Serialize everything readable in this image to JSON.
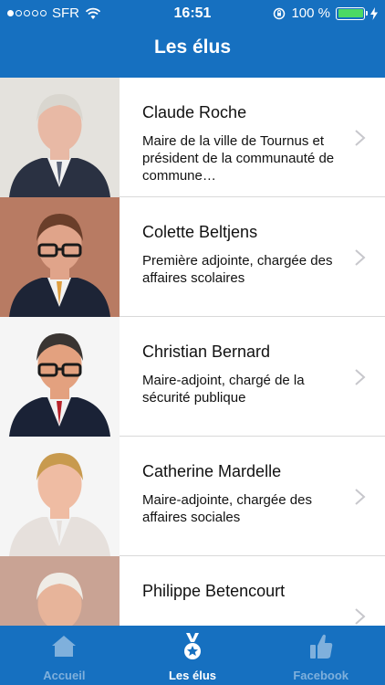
{
  "status_bar": {
    "carrier": "SFR",
    "time": "16:51",
    "battery": "100 %",
    "signal_dots_filled": 1,
    "signal_dots_total": 5
  },
  "nav": {
    "title": "Les élus"
  },
  "list": {
    "items": [
      {
        "name": "Claude Roche",
        "desc": "Maire de la ville de Tournus et président de la communauté de commune…",
        "photo_bg": "#e4e2dd",
        "jacket": "#2a3142",
        "skin": "#e8b9a5",
        "hair": "#d9d6cf",
        "tie": "#5a6377",
        "glasses": false
      },
      {
        "name": "Colette Beltjens",
        "desc": "Première adjointe, chargée des affaires scolaires",
        "photo_bg": "#b87b63",
        "jacket": "#1d2436",
        "skin": "#e0a48a",
        "hair": "#6a3e2a",
        "tie": "#e0a040",
        "glasses": true
      },
      {
        "name": "Christian Bernard",
        "desc": "Maire-adjoint, chargé de la sécurité publique",
        "photo_bg": "#f5f5f5",
        "jacket": "#1a2236",
        "skin": "#e3a17f",
        "hair": "#3a3532",
        "tie": "#b8222a",
        "glasses": true
      },
      {
        "name": "Catherine Mardelle",
        "desc": "Maire-adjointe, chargée des affaires sociales",
        "photo_bg": "#f5f5f5",
        "jacket": "#e6e0dc",
        "skin": "#efbca3",
        "hair": "#c89a4e",
        "tie": "#e6e0dc",
        "glasses": false
      },
      {
        "name": "Philippe Betencourt",
        "desc": "",
        "photo_bg": "#c9a394",
        "jacket": "#2a3142",
        "skin": "#e7b49a",
        "hair": "#efece6",
        "tie": "#5a6377",
        "glasses": false
      }
    ]
  },
  "tabbar": {
    "tabs": [
      {
        "label": "Accueil",
        "icon": "home-icon",
        "active": false
      },
      {
        "label": "Les élus",
        "icon": "medal-icon",
        "active": true
      },
      {
        "label": "Facebook",
        "icon": "thumbs-up-icon",
        "active": false
      }
    ]
  },
  "colors": {
    "brand_blue": "#1670c0",
    "inactive_tab": "#7fb0dc",
    "battery_green": "#4cd964"
  }
}
